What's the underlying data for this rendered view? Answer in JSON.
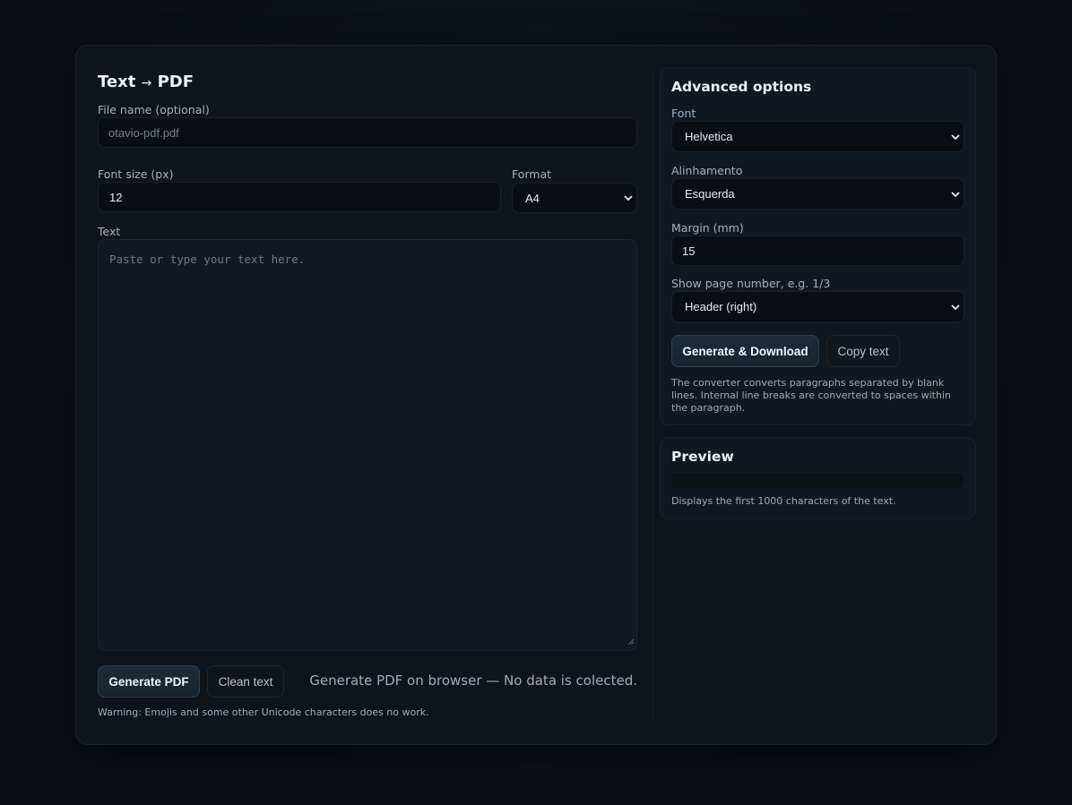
{
  "title": {
    "main": "Text",
    "arrow": "→",
    "target": "PDF"
  },
  "filename": {
    "label": "File name (optional)",
    "placeholder": "otavio-pdf.pdf"
  },
  "font_size": {
    "label": "Font size (px)",
    "value": "12"
  },
  "format": {
    "label": "Format",
    "selected": "A4"
  },
  "text": {
    "label": "Text",
    "placeholder": "Paste or type your text here."
  },
  "actions": {
    "generate_label": "Generate PDF",
    "clean_label": "Clean text",
    "info": "Generate PDF on browser — No data is colected.",
    "warning": "Warning: Emojis and some other Unicode characters does no work."
  },
  "advanced": {
    "title": "Advanced options",
    "font": {
      "label": "Font",
      "selected": "Helvetica"
    },
    "alignment": {
      "label": "Alinhamento",
      "selected": "Esquerda"
    },
    "margin": {
      "label": "Margin (mm)",
      "value": "15"
    },
    "page_number": {
      "label": "Show page number, e.g. 1/3",
      "selected": "Header (right)"
    },
    "download_label": "Generate & Download",
    "copy_label": "Copy text",
    "note": "The converter converts paragraphs separated by blank lines. Internal line breaks are converted to spaces within the paragraph."
  },
  "preview": {
    "title": "Preview",
    "note": "Displays the first 1000 characters of the text."
  },
  "icons": {
    "select_chevron": "chevron-down-icon",
    "resize_handle": "resize-grip-icon"
  },
  "colors": {
    "background": "#0c1015",
    "card": "#0f141a",
    "panel": "#111820",
    "primary_button": "#1a2834"
  }
}
